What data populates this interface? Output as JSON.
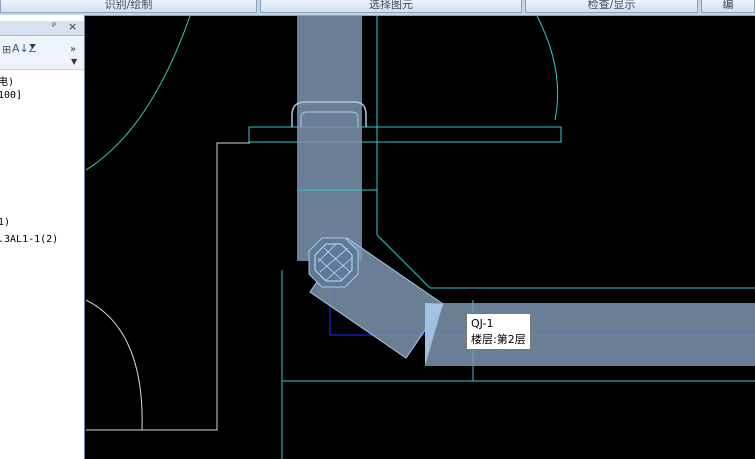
{
  "toolbar": {
    "buttons": [
      {
        "label": "识别/绘制"
      },
      {
        "label": "选择图元"
      },
      {
        "label": "检查/显示"
      },
      {
        "label": "编"
      }
    ]
  },
  "panel": {
    "pin_glyph": "ᵖ",
    "close_glyph": "×",
    "lines": [
      "电)",
      "100]",
      "1)",
      ".3AL1-1(2)"
    ]
  },
  "tooltip": {
    "name": "QJ-1",
    "floor": "楼层:第2层"
  },
  "colors": {
    "wall": "#7d95b0",
    "wall_light": "#a9c6e4",
    "cyan_line": "#37c6cf",
    "green_arc": "#3ed08e",
    "blue_line": "#2027ff",
    "white_line": "#d9d9d9"
  }
}
